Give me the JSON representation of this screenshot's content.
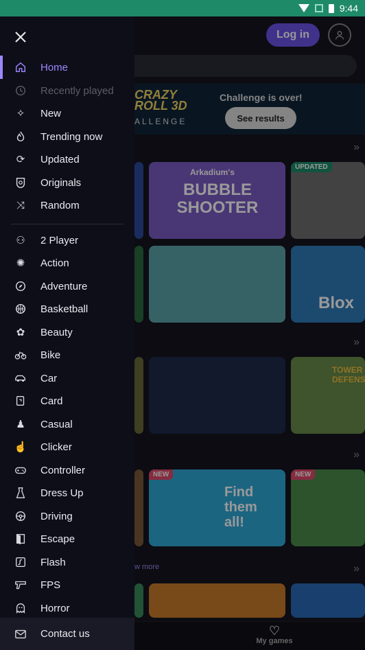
{
  "status": {
    "time": "9:44"
  },
  "header": {
    "login_label": "Log in"
  },
  "banner": {
    "title": "CRAZY ROLL 3D",
    "sub": "ALLENGE",
    "message": "Challenge is over!",
    "button": "See results"
  },
  "tiles": {
    "bubble": "BUBBLE SHOOTER",
    "bubble_brand": "Arkadium's",
    "updated_tag": "UPDATED",
    "blox": "Blox",
    "find": "Find them all!",
    "new1": "NEW",
    "new2": "NEW",
    "tower": "TOWER DEFENSE"
  },
  "see_more": "w more",
  "bottom_nav": {
    "my_games": "My games"
  },
  "drawer": {
    "items": [
      {
        "label": "Home",
        "icon": "home-icon"
      },
      {
        "label": "Recently played",
        "icon": "clock-icon"
      },
      {
        "label": "New",
        "icon": "sparkle-icon"
      },
      {
        "label": "Trending now",
        "icon": "flame-icon"
      },
      {
        "label": "Updated",
        "icon": "refresh-icon"
      },
      {
        "label": "Originals",
        "icon": "badge-icon"
      },
      {
        "label": "Random",
        "icon": "shuffle-icon"
      },
      {
        "label": "2 Player",
        "icon": "two-player-icon"
      },
      {
        "label": "Action",
        "icon": "action-icon"
      },
      {
        "label": "Adventure",
        "icon": "compass-icon"
      },
      {
        "label": "Basketball",
        "icon": "basketball-icon"
      },
      {
        "label": "Beauty",
        "icon": "flower-icon"
      },
      {
        "label": "Bike",
        "icon": "bike-icon"
      },
      {
        "label": "Car",
        "icon": "car-icon"
      },
      {
        "label": "Card",
        "icon": "card-icon"
      },
      {
        "label": "Casual",
        "icon": "casual-icon"
      },
      {
        "label": "Clicker",
        "icon": "clicker-icon"
      },
      {
        "label": "Controller",
        "icon": "controller-icon"
      },
      {
        "label": "Dress Up",
        "icon": "dress-icon"
      },
      {
        "label": "Driving",
        "icon": "steering-wheel-icon"
      },
      {
        "label": "Escape",
        "icon": "door-icon"
      },
      {
        "label": "Flash",
        "icon": "flash-icon"
      },
      {
        "label": "FPS",
        "icon": "gun-icon"
      },
      {
        "label": "Horror",
        "icon": "ghost-icon"
      }
    ],
    "contact": {
      "label": "Contact us",
      "icon": "mail-icon"
    }
  }
}
